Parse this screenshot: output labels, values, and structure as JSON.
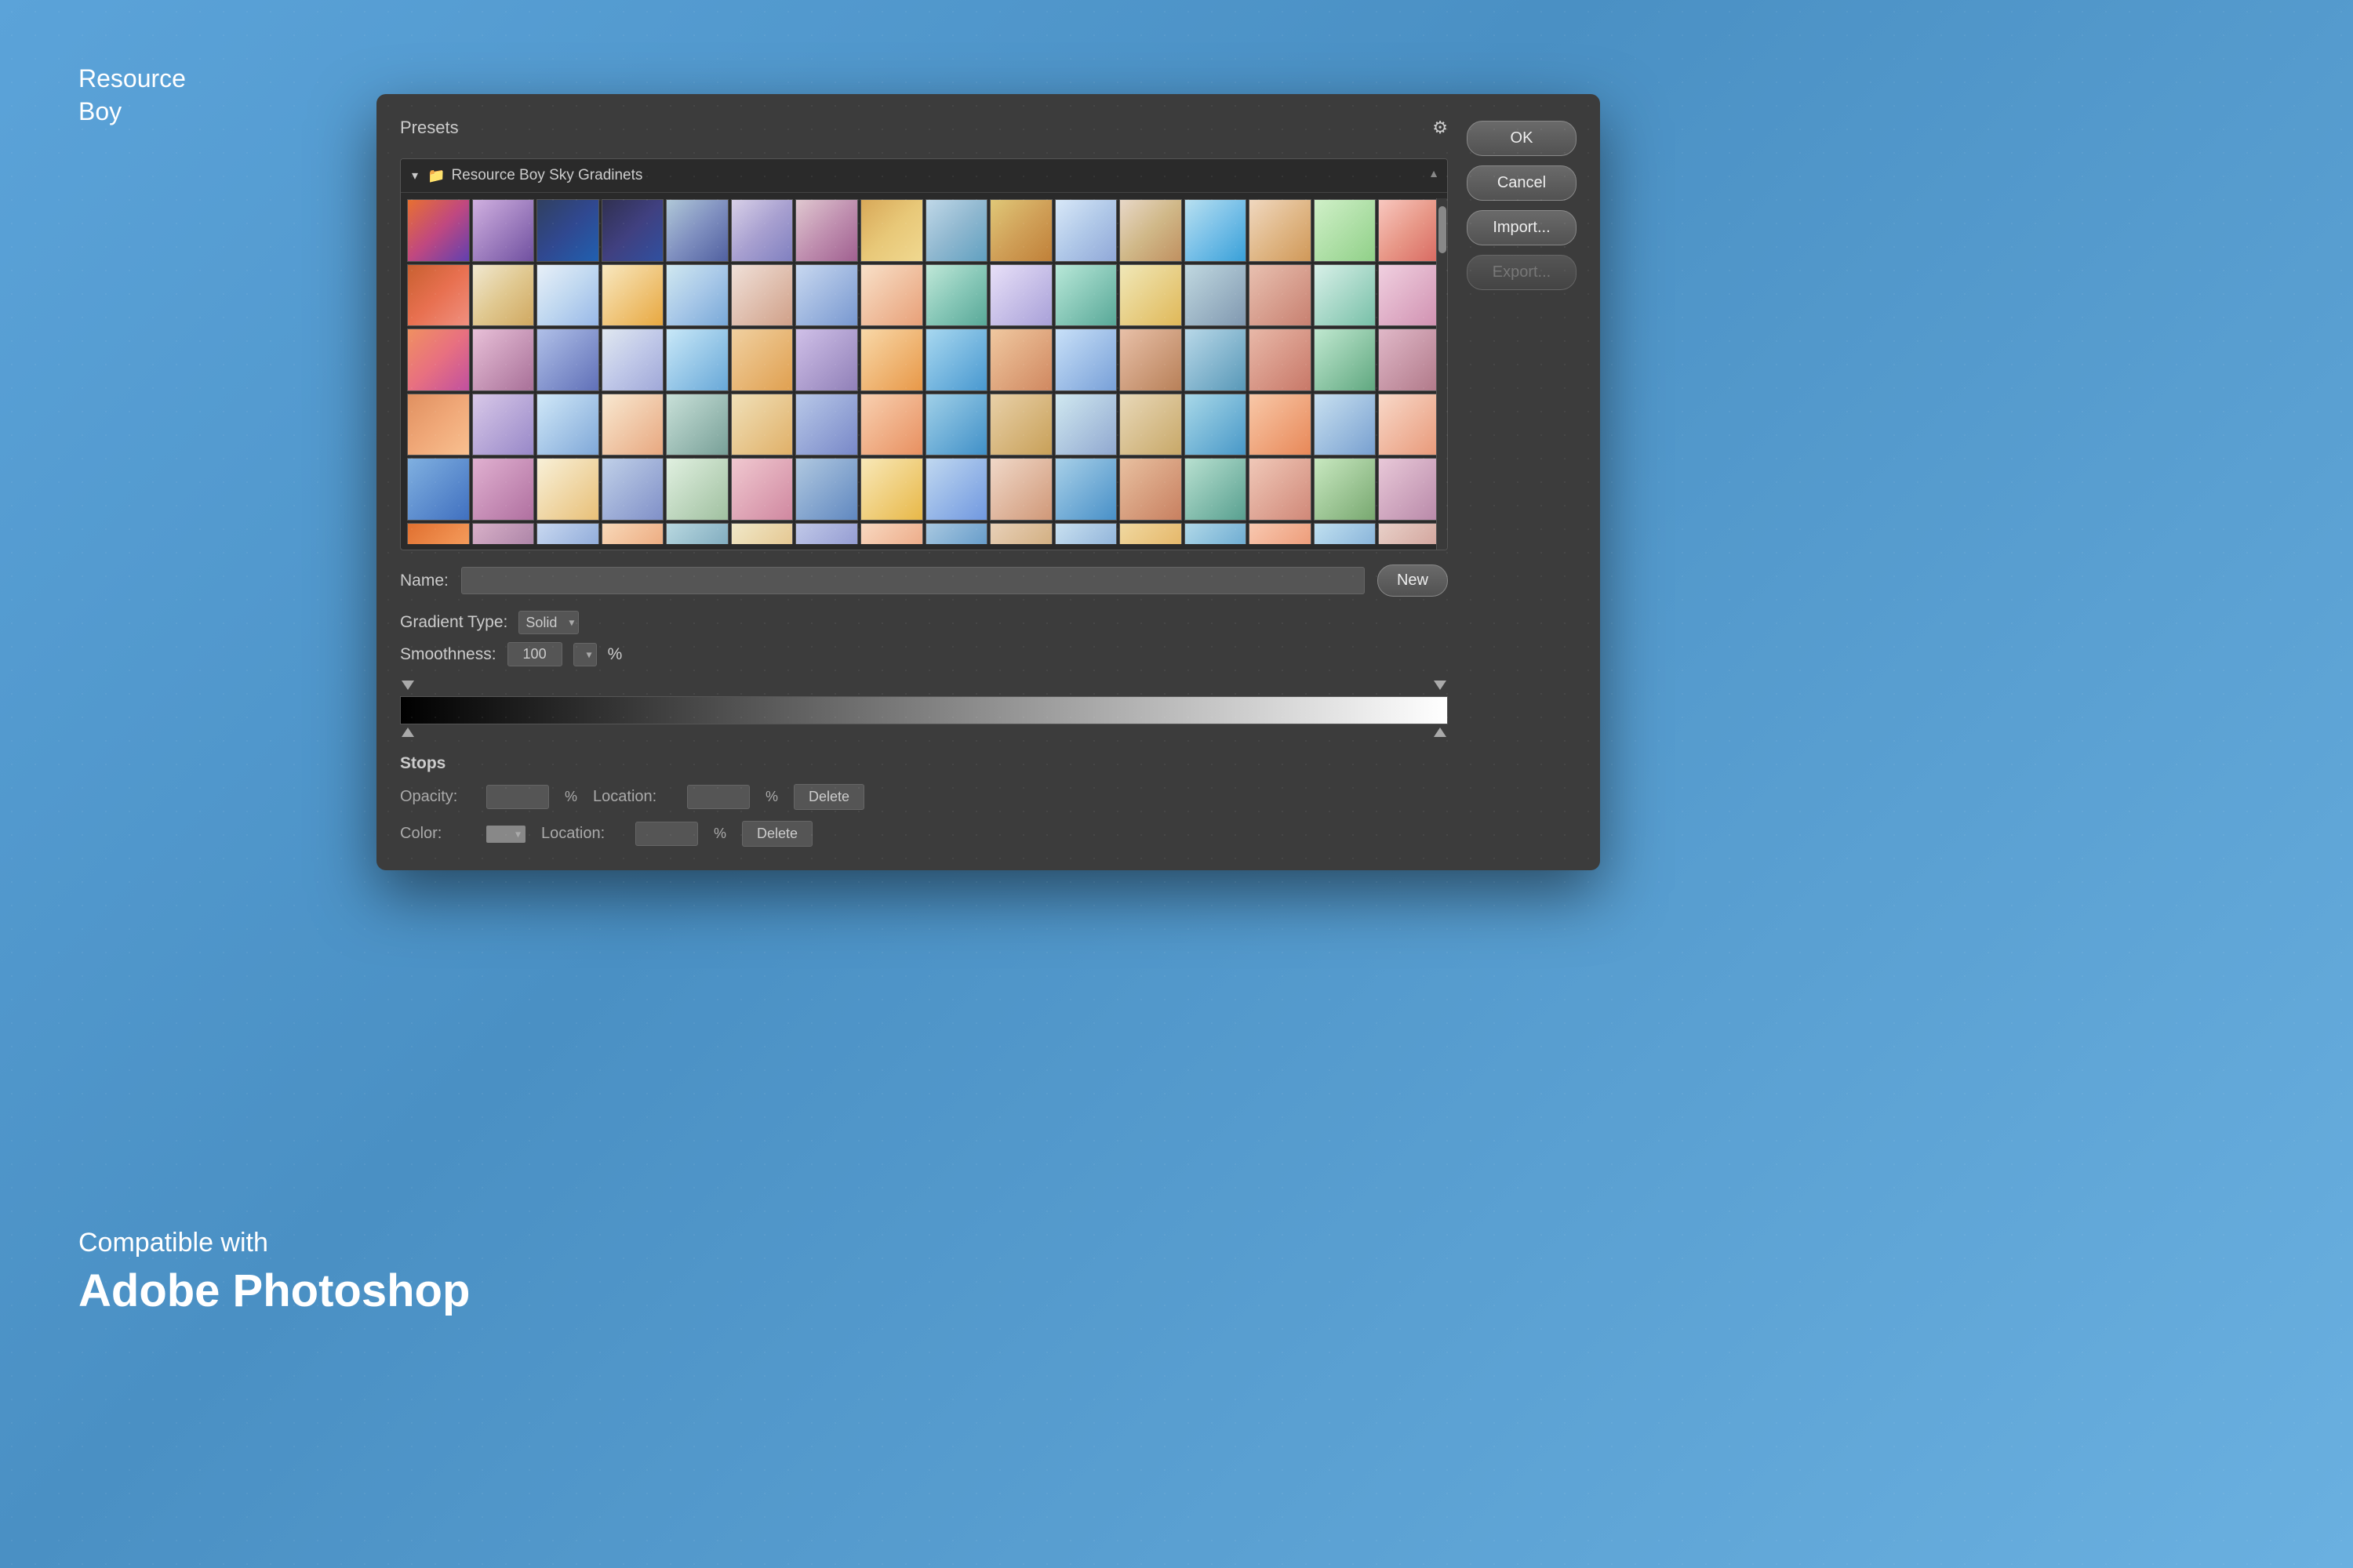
{
  "brand": {
    "name_line1": "Resource",
    "name_line2": "Boy"
  },
  "compatible": {
    "subtitle": "Compatible with",
    "title": "Adobe Photoshop"
  },
  "dialog": {
    "presets_label": "Presets",
    "folder_name": "Resource Boy Sky Gradinets",
    "name_label": "Name:",
    "name_placeholder": "",
    "gradient_type_label": "Gradient Type:",
    "gradient_type_value": "Solid",
    "smoothness_label": "Smoothness:",
    "smoothness_value": "100",
    "smoothness_pct": "%",
    "stops_title": "Stops",
    "opacity_label": "Opacity:",
    "opacity_pct": "%",
    "location_label": "Location:",
    "location_pct": "%",
    "delete_label": "Delete",
    "color_label": "Color:",
    "color_location_label": "Location:",
    "color_location_pct": "%",
    "color_delete_label": "Delete",
    "new_button": "New",
    "ok_button": "OK",
    "cancel_button": "Cancel",
    "import_button": "Import...",
    "export_button": "Export..."
  },
  "gradients": [
    {
      "colors": [
        "#e8a040",
        "#c04080",
        "#6040b0",
        "#2060c0"
      ],
      "type": "diagonal"
    },
    {
      "colors": [
        "#c0b0e0",
        "#a080d0",
        "#8060c0",
        "#6040a0"
      ],
      "type": "diagonal"
    },
    {
      "colors": [
        "#404060",
        "#3050a0",
        "#2060c0",
        "#1070d0"
      ],
      "type": "diagonal"
    },
    {
      "colors": [
        "#303050",
        "#404080",
        "#5060a0",
        "#3050c0"
      ],
      "type": "diagonal"
    },
    {
      "colors": [
        "#b0c0d0",
        "#8090c0",
        "#6070b0",
        "#4060a0"
      ],
      "type": "diagonal"
    },
    {
      "colors": [
        "#d0d0e0",
        "#a0a0d0",
        "#8080c0",
        "#6060b0"
      ],
      "type": "diagonal"
    },
    {
      "colors": [
        "#e0c0d0",
        "#c090b0",
        "#a06090",
        "#803070"
      ],
      "type": "diagonal"
    },
    {
      "colors": [
        "#d0a060",
        "#e0c080",
        "#f0d090",
        "#c0b060"
      ],
      "type": "diagonal"
    },
    {
      "colors": [
        "#c0d0e0",
        "#90b0d0",
        "#60a0c0",
        "#4090b0"
      ],
      "type": "diagonal"
    },
    {
      "colors": [
        "#e0c080",
        "#d0a060",
        "#c08040",
        "#b06020"
      ],
      "type": "diagonal"
    },
    {
      "colors": [
        "#d0e0f0",
        "#b0c0e0",
        "#90a0d0",
        "#7080c0"
      ],
      "type": "diagonal"
    },
    {
      "colors": [
        "#e0d0c0",
        "#d0b090",
        "#c09060",
        "#b07040"
      ],
      "type": "diagonal"
    },
    {
      "colors": [
        "#c0e0f0",
        "#80c0e0",
        "#40a0d0",
        "#2090c0"
      ],
      "type": "diagonal"
    },
    {
      "colors": [
        "#f0d0c0",
        "#e0b090",
        "#d09060",
        "#c07040"
      ],
      "type": "diagonal"
    },
    {
      "colors": [
        "#e0f0d0",
        "#c0e0b0",
        "#a0d090",
        "#80c070"
      ],
      "type": "diagonal"
    },
    {
      "colors": [
        "#f0c0c0",
        "#e09090",
        "#d06060",
        "#c04040"
      ],
      "type": "diagonal"
    }
  ]
}
